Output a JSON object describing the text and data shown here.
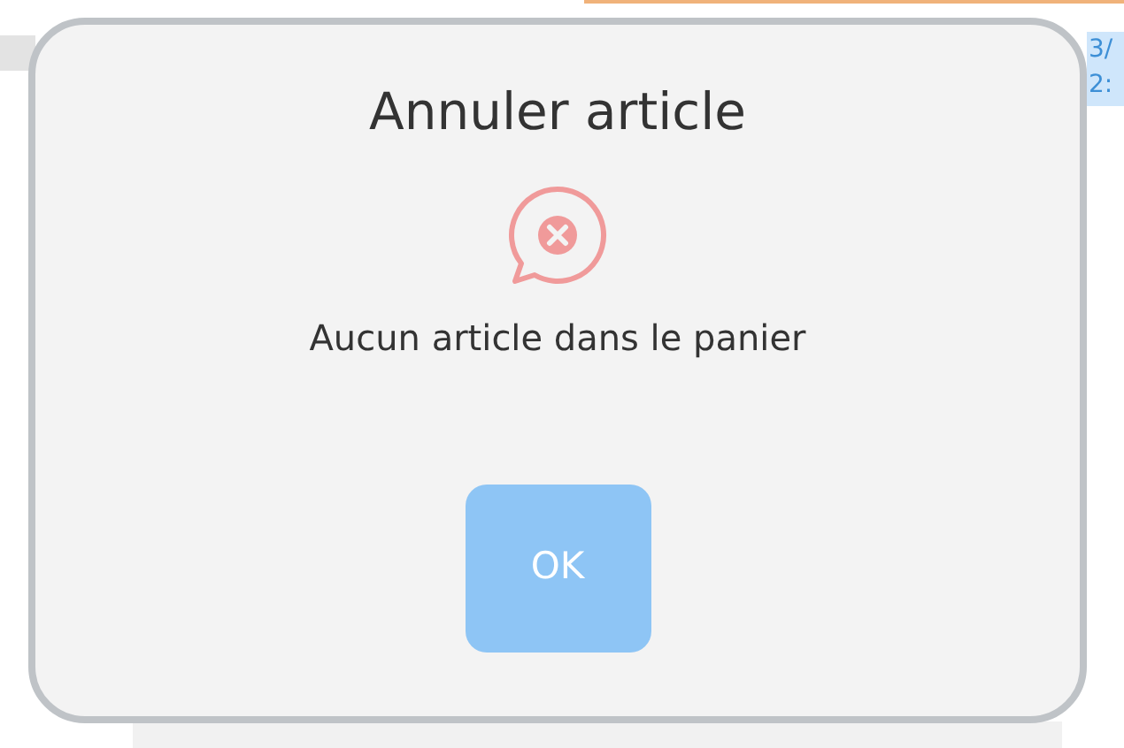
{
  "background": {
    "date_fragment": "3/",
    "time_fragment": "2:"
  },
  "dialog": {
    "title": "Annuler article",
    "message": "Aucun article dans le panier",
    "buttons": [
      {
        "label": "OK"
      }
    ]
  }
}
